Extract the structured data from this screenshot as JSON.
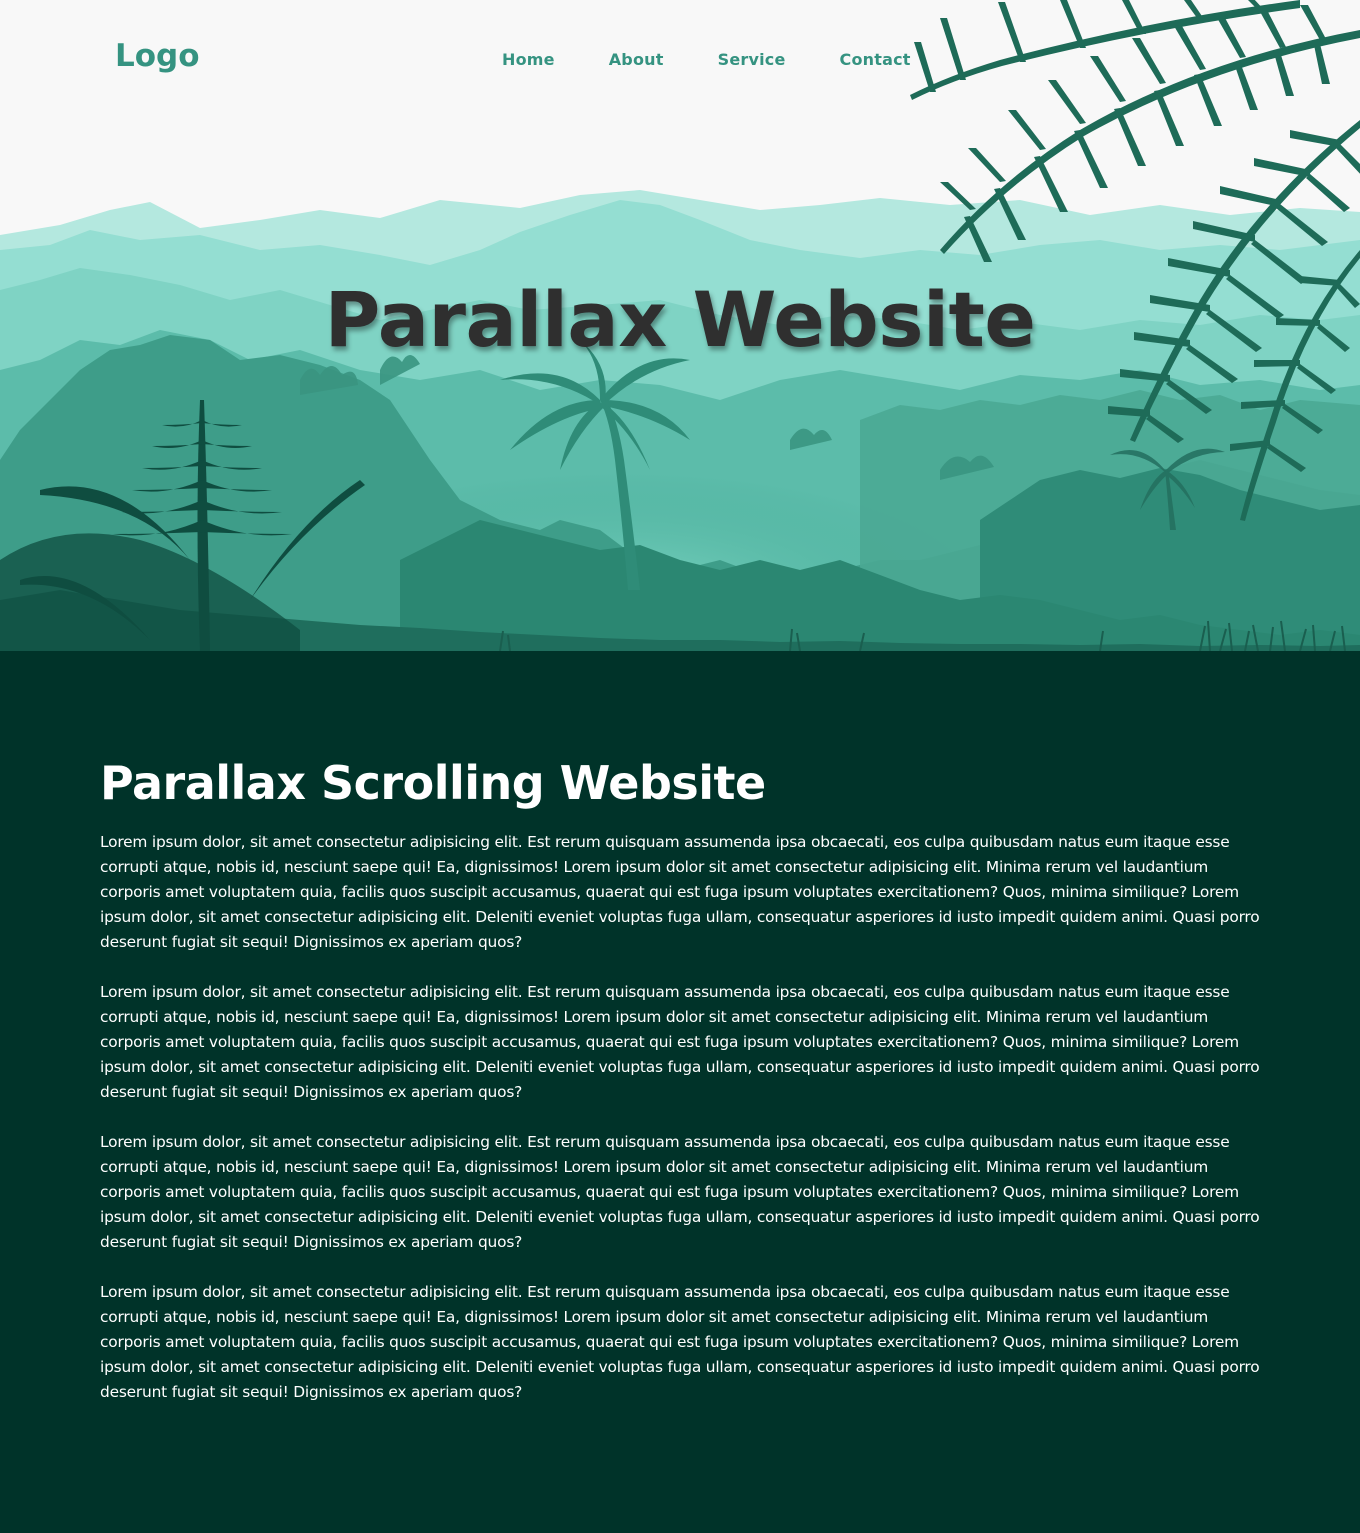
{
  "header": {
    "logo": "Logo",
    "nav": [
      {
        "label": "Home"
      },
      {
        "label": "About"
      },
      {
        "label": "Service"
      },
      {
        "label": "Contact"
      }
    ]
  },
  "hero": {
    "title": "Parallax Website",
    "illustration_icon": "jungle-landscape-illustration"
  },
  "content": {
    "heading": "Parallax Scrolling Website",
    "paragraphs": [
      "Lorem ipsum dolor, sit amet consectetur adipisicing elit. Est rerum quisquam assumenda ipsa obcaecati, eos culpa quibusdam natus eum itaque esse corrupti atque, nobis id, nesciunt saepe qui! Ea, dignissimos! Lorem ipsum dolor sit amet consectetur adipisicing elit. Minima rerum vel laudantium corporis amet voluptatem quia, facilis quos suscipit accusamus, quaerat qui est fuga ipsum voluptates exercitationem? Quos, minima similique? Lorem ipsum dolor, sit amet consectetur adipisicing elit. Deleniti eveniet voluptas fuga ullam, consequatur asperiores id iusto impedit quidem animi. Quasi porro deserunt fugiat sit sequi! Dignissimos ex aperiam quos?",
      "Lorem ipsum dolor, sit amet consectetur adipisicing elit. Est rerum quisquam assumenda ipsa obcaecati, eos culpa quibusdam natus eum itaque esse corrupti atque, nobis id, nesciunt saepe qui! Ea, dignissimos! Lorem ipsum dolor sit amet consectetur adipisicing elit. Minima rerum vel laudantium corporis amet voluptatem quia, facilis quos suscipit accusamus, quaerat qui est fuga ipsum voluptates exercitationem? Quos, minima similique? Lorem ipsum dolor, sit amet consectetur adipisicing elit. Deleniti eveniet voluptas fuga ullam, consequatur asperiores id iusto impedit quidem animi. Quasi porro deserunt fugiat sit sequi! Dignissimos ex aperiam quos?",
      "Lorem ipsum dolor, sit amet consectetur adipisicing elit. Est rerum quisquam assumenda ipsa obcaecati, eos culpa quibusdam natus eum itaque esse corrupti atque, nobis id, nesciunt saepe qui! Ea, dignissimos! Lorem ipsum dolor sit amet consectetur adipisicing elit. Minima rerum vel laudantium corporis amet voluptatem quia, facilis quos suscipit accusamus, quaerat qui est fuga ipsum voluptates exercitationem? Quos, minima similique? Lorem ipsum dolor, sit amet consectetur adipisicing elit. Deleniti eveniet voluptas fuga ullam, consequatur asperiores id iusto impedit quidem animi. Quasi porro deserunt fugiat sit sequi! Dignissimos ex aperiam quos?",
      "Lorem ipsum dolor, sit amet consectetur adipisicing elit. Est rerum quisquam assumenda ipsa obcaecati, eos culpa quibusdam natus eum itaque esse corrupti atque, nobis id, nesciunt saepe qui! Ea, dignissimos! Lorem ipsum dolor sit amet consectetur adipisicing elit. Minima rerum vel laudantium corporis amet voluptatem quia, facilis quos suscipit accusamus, quaerat qui est fuga ipsum voluptates exercitationem? Quos, minima similique? Lorem ipsum dolor, sit amet consectetur adipisicing elit. Deleniti eveniet voluptas fuga ullam, consequatur asperiores id iusto impedit quidem animi. Quasi porro deserunt fugiat sit sequi! Dignissimos ex aperiam quos?"
    ]
  },
  "colors": {
    "brand": "#359381",
    "content_bg": "#003329",
    "hero_bg": "#f8f8f8",
    "title": "#2f2f2f"
  }
}
